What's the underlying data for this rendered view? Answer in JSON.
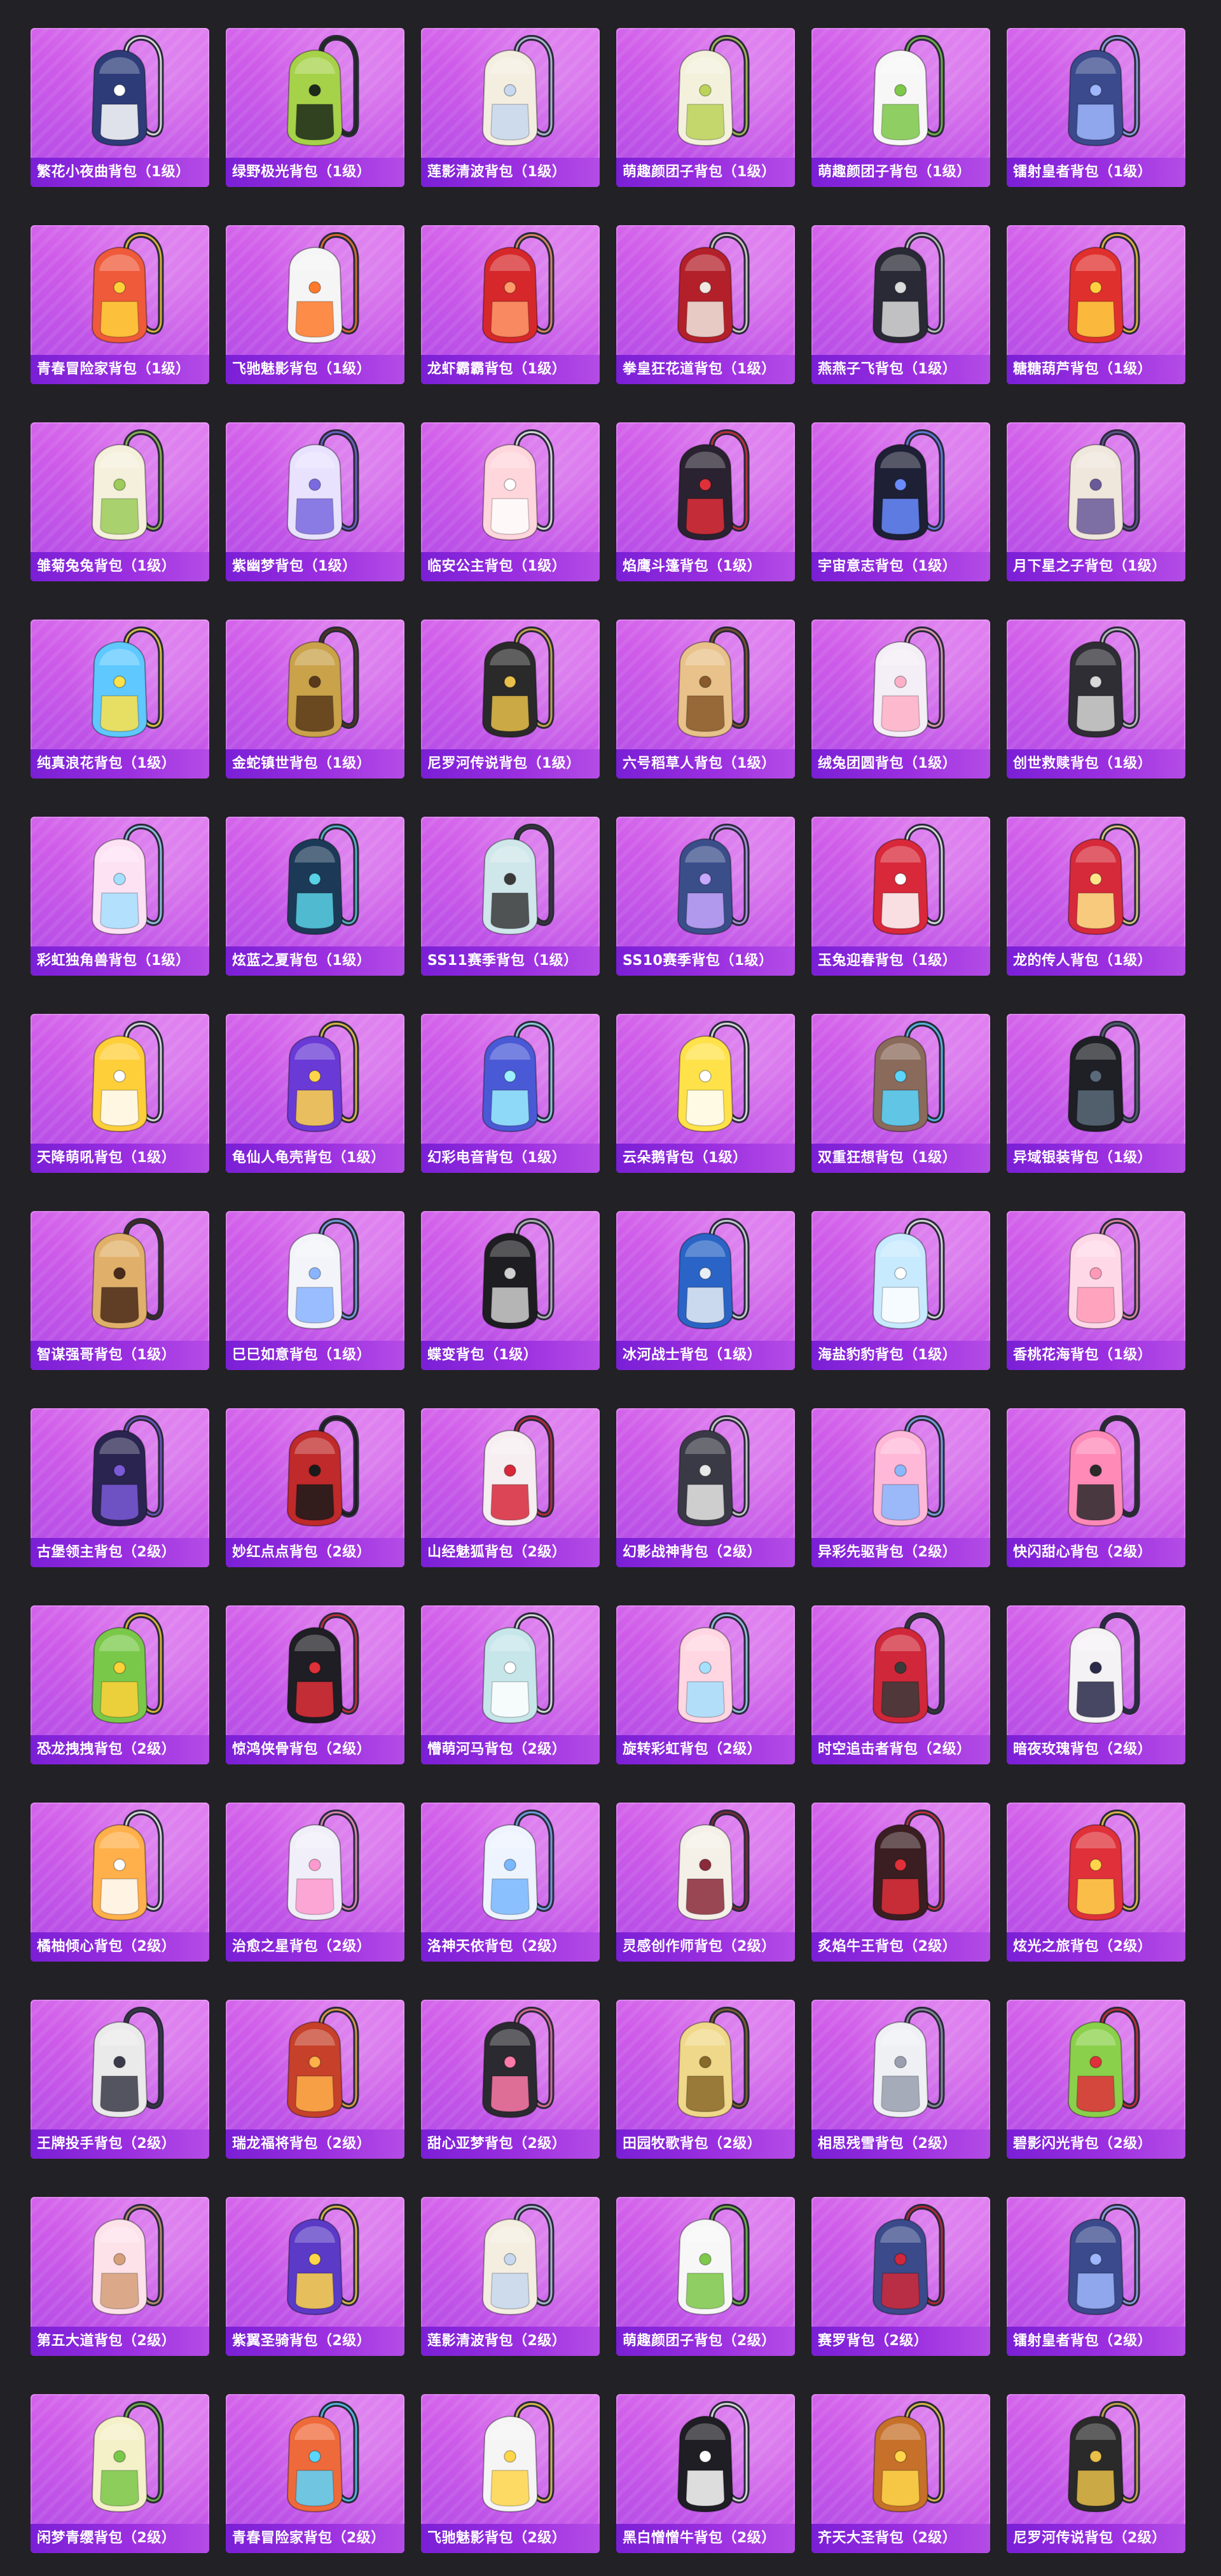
{
  "items": [
    {
      "label": "繁花小夜曲背包（1级）",
      "icon": "backpack-icon",
      "color": "#2d3c78",
      "accent": "#ffffff"
    },
    {
      "label": "绿野极光背包（1级）",
      "icon": "backpack-icon",
      "color": "#a6d24a",
      "accent": "#1d2a1a"
    },
    {
      "label": "莲影清波背包（1级）",
      "icon": "backpack-icon",
      "color": "#f3eee0",
      "accent": "#c7d8f0"
    },
    {
      "label": "萌趣颜团子背包（1级）",
      "icon": "backpack-icon",
      "color": "#f3f1dc",
      "accent": "#bcd35a"
    },
    {
      "label": "萌趣颜团子背包（1级）",
      "icon": "backpack-icon",
      "color": "#f7f7f7",
      "accent": "#7ec84a"
    },
    {
      "label": "镭射皇者背包（1级）",
      "icon": "backpack-icon",
      "color": "#3a4a8c",
      "accent": "#9fb7ff"
    },
    {
      "label": "青春冒险家背包（1级）",
      "icon": "backpack-icon",
      "color": "#ef5a3a",
      "accent": "#ffd23a"
    },
    {
      "label": "飞驰魅影背包（1级）",
      "icon": "backpack-icon",
      "color": "#f5f5f5",
      "accent": "#ff7a2a"
    },
    {
      "label": "龙虾霸霸背包（1级）",
      "icon": "backpack-icon",
      "color": "#d6282a",
      "accent": "#ff9a6a"
    },
    {
      "label": "拳皇狂花道背包（1级）",
      "icon": "backpack-icon",
      "color": "#b4202a",
      "accent": "#f0e8e0"
    },
    {
      "label": "燕燕子飞背包（1级）",
      "icon": "backpack-icon",
      "color": "#2a2a36",
      "accent": "#dcdcdc"
    },
    {
      "label": "糖糖葫芦背包（1级）",
      "icon": "backpack-icon",
      "color": "#e0302e",
      "accent": "#ffd040"
    },
    {
      "label": "雏菊兔兔背包（1级）",
      "icon": "backpack-icon",
      "color": "#f4f0dc",
      "accent": "#9dcc5a"
    },
    {
      "label": "紫幽梦背包（1级）",
      "icon": "backpack-icon",
      "color": "#e8e2ff",
      "accent": "#7a6ae0"
    },
    {
      "label": "临安公主背包（1级）",
      "icon": "backpack-icon",
      "color": "#ffd6dc",
      "accent": "#ffffff"
    },
    {
      "label": "焰鹰斗篷背包（1级）",
      "icon": "backpack-icon",
      "color": "#2a2230",
      "accent": "#e0303a"
    },
    {
      "label": "宇宙意志背包（1级）",
      "icon": "backpack-icon",
      "color": "#1e2036",
      "accent": "#6a8cff"
    },
    {
      "label": "月下星之子背包（1级）",
      "icon": "backpack-icon",
      "color": "#efe6dc",
      "accent": "#6a5a9a"
    },
    {
      "label": "纯真浪花背包（1级）",
      "icon": "backpack-icon",
      "color": "#5ec8ff",
      "accent": "#ffe24a"
    },
    {
      "label": "金蛇镇世背包（1级）",
      "icon": "backpack-icon",
      "color": "#c9a24a",
      "accent": "#5a3a1a"
    },
    {
      "label": "尼罗河传说背包（1级）",
      "icon": "backpack-icon",
      "color": "#2a2a2a",
      "accent": "#e8c04a"
    },
    {
      "label": "六号稻草人背包（1级）",
      "icon": "backpack-icon",
      "color": "#e8c28a",
      "accent": "#8a5a2a"
    },
    {
      "label": "绒兔团圆背包（1级）",
      "icon": "backpack-icon",
      "color": "#f4eef6",
      "accent": "#ffb0c8"
    },
    {
      "label": "创世救赎背包（1级）",
      "icon": "backpack-icon",
      "color": "#2e2e34",
      "accent": "#d8d8d8"
    },
    {
      "label": "彩虹独角兽背包（1级）",
      "icon": "backpack-icon",
      "color": "#fde2f4",
      "accent": "#a6e0ff"
    },
    {
      "label": "炫蓝之夏背包（1级）",
      "icon": "backpack-icon",
      "color": "#1c3a58",
      "accent": "#5ad2e6"
    },
    {
      "label": "SS11赛季背包（1级）",
      "icon": "backpack-icon",
      "color": "#cfe6ea",
      "accent": "#3a3a3a"
    },
    {
      "label": "SS10赛季背包（1级）",
      "icon": "backpack-icon",
      "color": "#3a4e8a",
      "accent": "#c6a8ff"
    },
    {
      "label": "玉兔迎春背包（1级）",
      "icon": "backpack-icon",
      "color": "#d8283a",
      "accent": "#ffffff"
    },
    {
      "label": "龙的传人背包（1级）",
      "icon": "backpack-icon",
      "color": "#d62a3a",
      "accent": "#ffe68a"
    },
    {
      "label": "天降萌吼背包（1级）",
      "icon": "backpack-icon",
      "color": "#ffcf3a",
      "accent": "#ffffff"
    },
    {
      "label": "龟仙人龟壳背包（1级）",
      "icon": "backpack-icon",
      "color": "#6a3ad6",
      "accent": "#ffd64a"
    },
    {
      "label": "幻彩电音背包（1级）",
      "icon": "backpack-icon",
      "color": "#4a5ad6",
      "accent": "#9cf0ff"
    },
    {
      "label": "云朵鹅背包（1级）",
      "icon": "backpack-icon",
      "color": "#ffe24a",
      "accent": "#ffffff"
    },
    {
      "label": "双重狂想背包（1级）",
      "icon": "backpack-icon",
      "color": "#8a6a5a",
      "accent": "#5ad6ff"
    },
    {
      "label": "异域银装背包（1级）",
      "icon": "backpack-icon",
      "color": "#1e2026",
      "accent": "#5a6a7a"
    },
    {
      "label": "智谋强哥背包（1级）",
      "icon": "backpack-icon",
      "color": "#e0b06a",
      "accent": "#4a2a1a"
    },
    {
      "label": "巳巳如意背包（1级）",
      "icon": "backpack-icon",
      "color": "#f2f4fa",
      "accent": "#8ab4ff"
    },
    {
      "label": "蝶变背包（1级）",
      "icon": "backpack-icon",
      "color": "#1e1e22",
      "accent": "#d0d0d0"
    },
    {
      "label": "冰河战士背包（1级）",
      "icon": "backpack-icon",
      "color": "#2a64c6",
      "accent": "#e8eef6"
    },
    {
      "label": "海盐豹豹背包（1级）",
      "icon": "backpack-icon",
      "color": "#c8eaff",
      "accent": "#ffffff"
    },
    {
      "label": "香桃花海背包（1级）",
      "icon": "backpack-icon",
      "color": "#ffd8e8",
      "accent": "#ff9ab8"
    },
    {
      "label": "古堡领主背包（2级）",
      "icon": "backpack-icon",
      "color": "#2a2450",
      "accent": "#7a5ad6"
    },
    {
      "label": "妙红点点背包（2级）",
      "icon": "backpack-icon",
      "color": "#c02a2a",
      "accent": "#1a1a1a"
    },
    {
      "label": "山经魅狐背包（2级）",
      "icon": "backpack-icon",
      "color": "#f6eef0",
      "accent": "#d8283a"
    },
    {
      "label": "幻影战神背包（2级）",
      "icon": "backpack-icon",
      "color": "#3a3a46",
      "accent": "#e8e8e8"
    },
    {
      "label": "异彩先驱背包（2级）",
      "icon": "backpack-icon",
      "color": "#ffb8d8",
      "accent": "#8ab8ff"
    },
    {
      "label": "快闪甜心背包（2级）",
      "icon": "backpack-icon",
      "color": "#ff8ab8",
      "accent": "#2a2a2a"
    },
    {
      "label": "恐龙拽拽背包（2级）",
      "icon": "backpack-icon",
      "color": "#7ac84a",
      "accent": "#ffd23a"
    },
    {
      "label": "惊鸿侠骨背包（2级）",
      "icon": "backpack-icon",
      "color": "#1e1e24",
      "accent": "#e0303a"
    },
    {
      "label": "懵萌河马背包（2级）",
      "icon": "backpack-icon",
      "color": "#c6e6ea",
      "accent": "#ffffff"
    },
    {
      "label": "旋转彩虹背包（2级）",
      "icon": "backpack-icon",
      "color": "#ffd6e2",
      "accent": "#a6e0ff"
    },
    {
      "label": "时空追击者背包（2级）",
      "icon": "backpack-icon",
      "color": "#d0283a",
      "accent": "#3a3a3a"
    },
    {
      "label": "暗夜玫瑰背包（2级）",
      "icon": "backpack-icon",
      "color": "#f4f2f4",
      "accent": "#2a2a4a"
    },
    {
      "label": "橘柚倾心背包（2级）",
      "icon": "backpack-icon",
      "color": "#ffb04a",
      "accent": "#ffffff"
    },
    {
      "label": "治愈之星背包（2级）",
      "icon": "backpack-icon",
      "color": "#f0eef8",
      "accent": "#ff9ad0"
    },
    {
      "label": "洛神天依背包（2级）",
      "icon": "backpack-icon",
      "color": "#eef4ff",
      "accent": "#7ab8ff"
    },
    {
      "label": "灵感创作师背包（2级）",
      "icon": "backpack-icon",
      "color": "#f4f0e8",
      "accent": "#8a2a3a"
    },
    {
      "label": "炙焰牛王背包（2级）",
      "icon": "backpack-icon",
      "color": "#3a1e22",
      "accent": "#e0303a"
    },
    {
      "label": "炫光之旅背包（2级）",
      "icon": "backpack-icon",
      "color": "#e0303a",
      "accent": "#ffd64a"
    },
    {
      "label": "王牌投手背包（2级）",
      "icon": "backpack-icon",
      "color": "#eaeaea",
      "accent": "#3a3a4a"
    },
    {
      "label": "瑞龙福将背包（2级）",
      "icon": "backpack-icon",
      "color": "#c6402a",
      "accent": "#ffb04a"
    },
    {
      "label": "甜心亚梦背包（2级）",
      "icon": "backpack-icon",
      "color": "#2a2a30",
      "accent": "#ff7aa8"
    },
    {
      "label": "田园牧歌背包（2级）",
      "icon": "backpack-icon",
      "color": "#f0d88a",
      "accent": "#8a6a2a"
    },
    {
      "label": "相思残雪背包（2级）",
      "icon": "backpack-icon",
      "color": "#eef0f4",
      "accent": "#9aa0b0"
    },
    {
      "label": "碧影闪光背包（2级）",
      "icon": "backpack-icon",
      "color": "#8ad04a",
      "accent": "#e0303a"
    },
    {
      "label": "第五大道背包（2级）",
      "icon": "backpack-icon",
      "color": "#fde2ea",
      "accent": "#d6a07a"
    },
    {
      "label": "紫翼圣骑背包（2级）",
      "icon": "backpack-icon",
      "color": "#5a3ac6",
      "accent": "#ffd64a"
    },
    {
      "label": "莲影清波背包（2级）",
      "icon": "backpack-icon",
      "color": "#f3eee0",
      "accent": "#c7d8f0"
    },
    {
      "label": "萌趣颜团子背包（2级）",
      "icon": "backpack-icon",
      "color": "#f7f7f7",
      "accent": "#7ec84a"
    },
    {
      "label": "赛罗背包（2级）",
      "icon": "backpack-icon",
      "color": "#3a4a8a",
      "accent": "#d0283a"
    },
    {
      "label": "镭射皇者背包（2级）",
      "icon": "backpack-icon",
      "color": "#3a4a8c",
      "accent": "#9fb7ff"
    },
    {
      "label": "闲梦青缨背包（2级）",
      "icon": "backpack-icon",
      "color": "#f4f0c8",
      "accent": "#7ac84a"
    },
    {
      "label": "青春冒险家背包（2级）",
      "icon": "backpack-icon",
      "color": "#ef6a3a",
      "accent": "#5ad6ff"
    },
    {
      "label": "飞驰魅影背包（2级）",
      "icon": "backpack-icon",
      "color": "#f5f5f5",
      "accent": "#ffd64a"
    },
    {
      "label": "黑白憎憎牛背包（2级）",
      "icon": "backpack-icon",
      "color": "#1e1e24",
      "accent": "#ffffff"
    },
    {
      "label": "齐天大圣背包（2级）",
      "icon": "backpack-icon",
      "color": "#c6702a",
      "accent": "#ffd64a"
    },
    {
      "label": "尼罗河传说背包（2级）",
      "icon": "backpack-icon",
      "color": "#2a2a2a",
      "accent": "#e8c04a"
    }
  ]
}
